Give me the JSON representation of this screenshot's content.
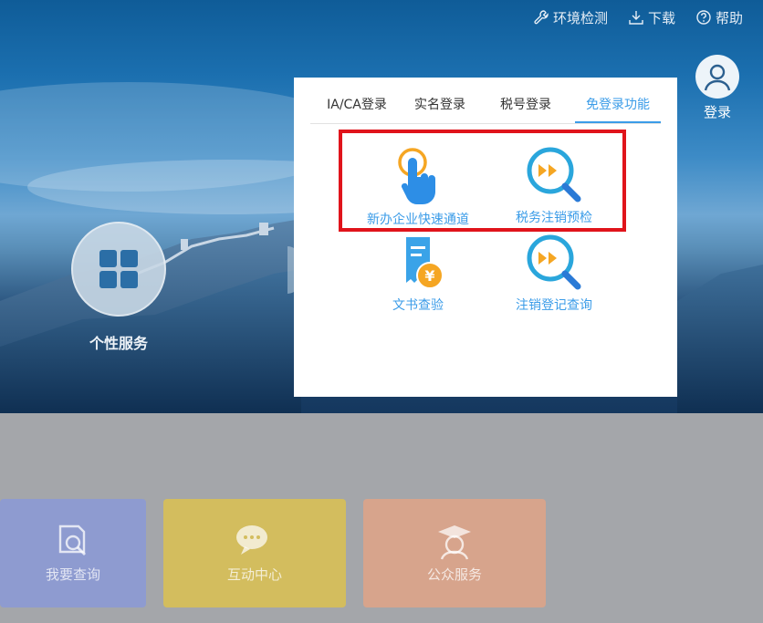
{
  "topbar": {
    "items": [
      {
        "label": "环境检测",
        "icon": "wrench-icon"
      },
      {
        "label": "下载",
        "icon": "download-icon"
      },
      {
        "label": "帮助",
        "icon": "help-circle-icon"
      }
    ]
  },
  "login": {
    "label": "登录",
    "icon": "user-icon"
  },
  "personal": {
    "label": "个性服务",
    "icon": "grid-icon"
  },
  "panel": {
    "tabs": [
      {
        "label": "IA/CA登录",
        "active": false
      },
      {
        "label": "实名登录",
        "active": false
      },
      {
        "label": "税号登录",
        "active": false
      },
      {
        "label": "免登录功能",
        "active": true
      }
    ],
    "services": [
      {
        "label": "新办企业快速通道",
        "icon": "tap-finger-icon"
      },
      {
        "label": "税务注销预检",
        "icon": "magnifier-arrows-icon"
      },
      {
        "label": "文书查验",
        "icon": "document-yuan-icon"
      },
      {
        "label": "注销登记查询",
        "icon": "magnifier-arrows-icon"
      }
    ]
  },
  "cards": [
    {
      "label": "我要查询",
      "icon": "document-search-icon",
      "color": "#8e9bd0"
    },
    {
      "label": "互动中心",
      "icon": "chat-bubbles-icon",
      "color": "#d3bd5e"
    },
    {
      "label": "公众服务",
      "icon": "graduate-icon",
      "color": "#d7a48c"
    }
  ],
  "colors": {
    "accent": "#3b9ce8",
    "highlight": "#e0141b"
  }
}
